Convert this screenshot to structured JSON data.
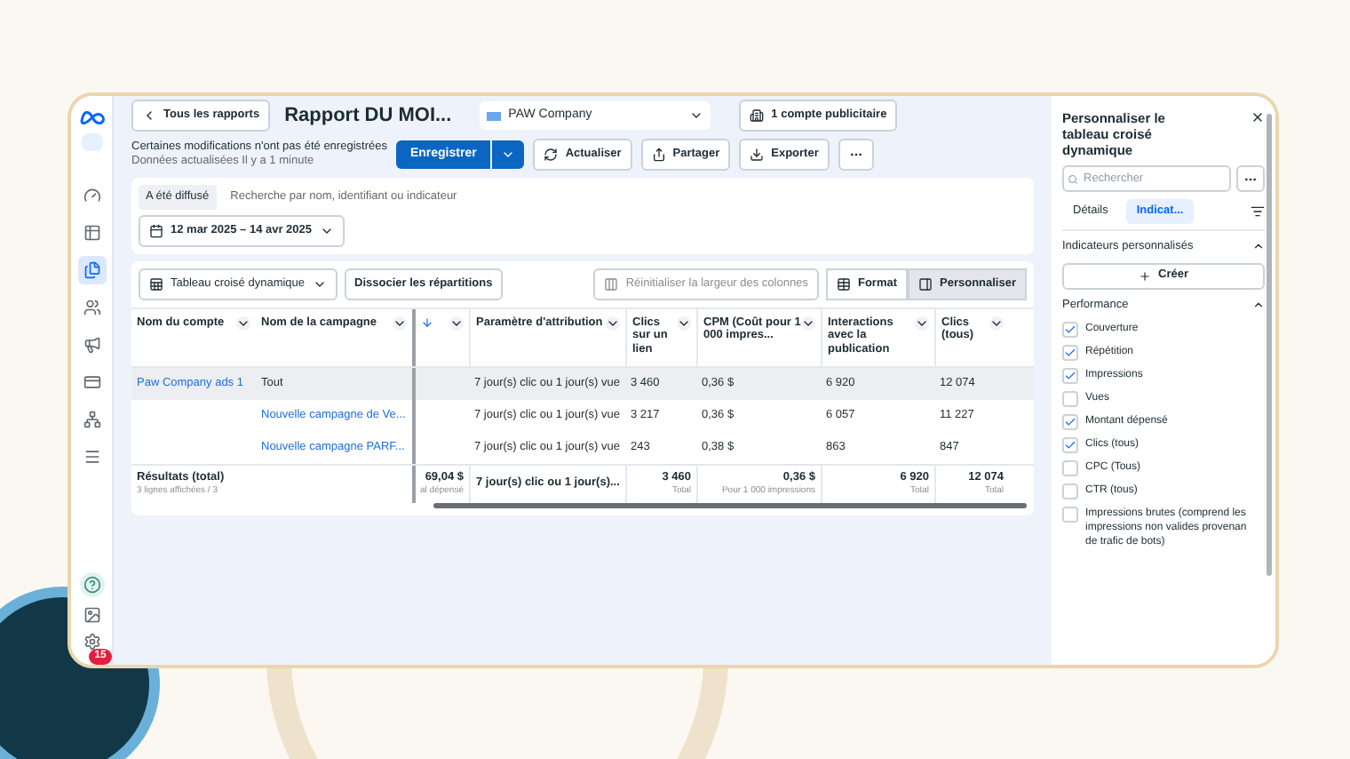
{
  "header": {
    "back_button": "Tous les rapports",
    "report_title": "Rapport DU MOI...",
    "account_select": "PAW Company",
    "ad_accounts_button": "1 compte publicitaire",
    "unsaved_notice": "Certaines modifications n'ont pas été enregistrées",
    "updated_notice": "Données actualisées Il y a 1 minute",
    "save_button": "Enregistrer",
    "refresh_button": "Actualiser",
    "share_button": "Partager",
    "export_button": "Exporter"
  },
  "sidebar": {
    "items": [
      {
        "selected": false
      },
      {
        "selected": false
      },
      {
        "selected": true
      },
      {
        "selected": false
      },
      {
        "selected": false
      },
      {
        "selected": false
      },
      {
        "selected": false
      },
      {
        "selected": false
      }
    ],
    "settings_badge": "15"
  },
  "filters": {
    "chip": "A été diffusé",
    "search_placeholder": "Recherche par nom, identifiant ou indicateur",
    "date_range": "12 mar 2025 – 14 avr 2025"
  },
  "toolbar": {
    "view_select": "Tableau croisé dynamique",
    "split_button": "Dissocier les répartitions",
    "reset_button": "Réinitialiser la largeur des colonnes",
    "tabs": [
      {
        "label": "Format",
        "selected": false
      },
      {
        "label": "Personnaliser",
        "selected": true
      }
    ]
  },
  "table": {
    "columns": [
      "Nom du compte",
      "Nom de la campagne",
      "",
      "Paramètre d'attribution",
      "Clics sur un lien",
      "CPM (Coût pour 1 000 impres...",
      "Interactions avec la publication",
      "Clics (tous)"
    ],
    "rows": [
      {
        "selected": true,
        "cells": [
          "Paw Company ads 1",
          "Tout",
          "",
          "7 jour(s) clic ou 1 jour(s) vue",
          "3 460",
          "0,36 $",
          "6 920",
          "12 074"
        ]
      },
      {
        "selected": false,
        "cells": [
          "",
          "Nouvelle campagne de Ve...",
          "",
          "7 jour(s) clic ou 1 jour(s) vue",
          "3 217",
          "0,36 $",
          "6 057",
          "11 227"
        ]
      },
      {
        "selected": false,
        "cells": [
          "",
          "Nouvelle campagne PARF...",
          "",
          "7 jour(s) clic ou 1 jour(s) vue",
          "243",
          "0,38 $",
          "863",
          "847"
        ]
      }
    ],
    "totals": [
      {
        "value": "Résultats (total)",
        "note": "3 lignes affichées / 3"
      },
      {
        "value": "69,04 $",
        "note": "al dépensé"
      },
      {
        "value": "7 jour(s) clic ou 1 jour(s)..."
      },
      {
        "value": "3 460",
        "note": "Total"
      },
      {
        "value": "0,36 $",
        "note": "Pour 1 000 impressions"
      },
      {
        "value": "6 920",
        "note": "Total"
      },
      {
        "value": "12 074",
        "note": "Total"
      }
    ]
  },
  "panel": {
    "title": "Personnaliser le tableau croisé dynamique",
    "search_placeholder": "Rechercher",
    "tabs": [
      {
        "label": "Détails",
        "selected": false
      },
      {
        "label": "Indicat...",
        "selected": true
      }
    ],
    "custom_section": "Indicateurs personnalisés",
    "create_button": "Créer",
    "performance_section": "Performance",
    "metrics": [
      {
        "label": "Couverture",
        "checked": true
      },
      {
        "label": "Répétition",
        "checked": true
      },
      {
        "label": "Impressions",
        "checked": true
      },
      {
        "label": "Vues",
        "checked": false
      },
      {
        "label": "Montant dépensé",
        "checked": true
      },
      {
        "label": "Clics (tous)",
        "checked": true
      },
      {
        "label": "CPC (Tous)",
        "checked": false
      },
      {
        "label": "CTR (tous)",
        "checked": false
      },
      {
        "label": "Impressions brutes (comprend les impressions non valides provenan de trafic de bots)",
        "checked": false
      }
    ]
  }
}
